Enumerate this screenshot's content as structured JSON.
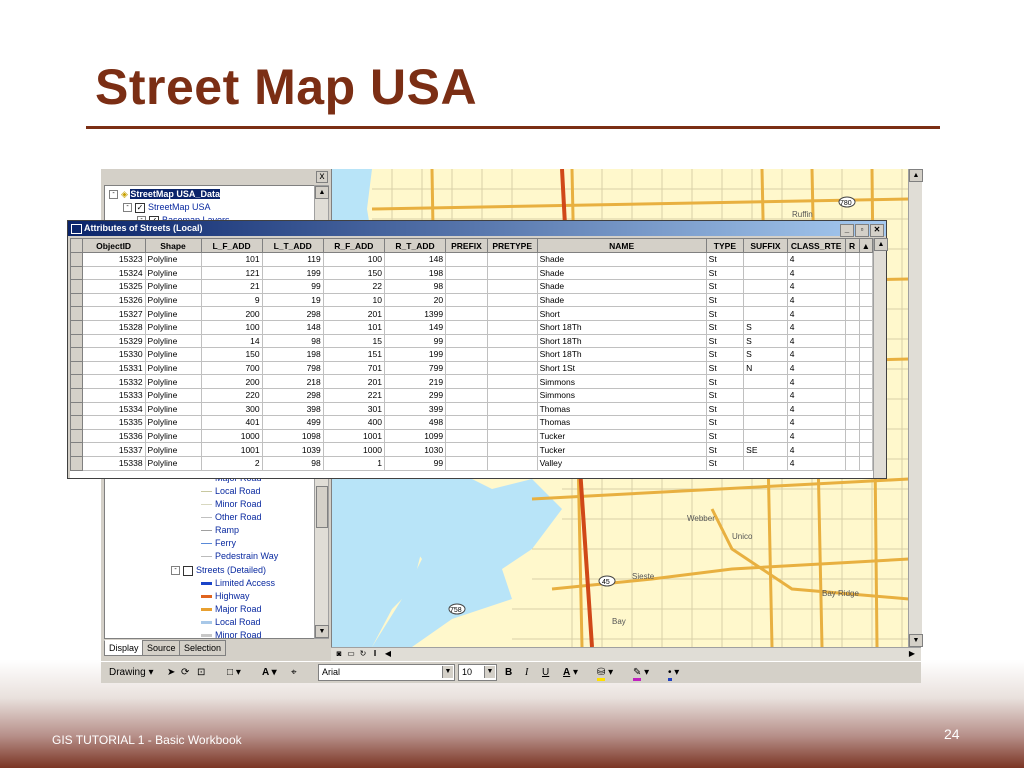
{
  "slide": {
    "title": "Street Map USA",
    "footer": "GIS TUTORIAL 1 - Basic Workbook",
    "page_number": "24"
  },
  "toc": {
    "close_glyph": "x",
    "tree_top": [
      {
        "label": "StreetMap USA_Data",
        "indent": 0,
        "expander": "-",
        "checkbox": false,
        "highlight": true
      },
      {
        "label": "StreetMap USA",
        "indent": 1,
        "expander": "-",
        "checkbox": true
      },
      {
        "label": "Basemap Layers",
        "indent": 2,
        "expander": "-",
        "checkbox": true
      }
    ],
    "legend_items": [
      {
        "label": "Major Road",
        "color": "#c8a060"
      },
      {
        "label": "Local Road",
        "color": "#c8c8a0"
      },
      {
        "label": "Minor Road",
        "color": "#d8d8c0"
      },
      {
        "label": "Other Road",
        "color": "#c0c0c0"
      },
      {
        "label": "Ramp",
        "color": "#a0a0a0"
      },
      {
        "label": "Ferry",
        "color": "#5a8ad8"
      },
      {
        "label": "Pedestrain Way",
        "color": "#ffffff"
      }
    ],
    "streets_detailed": "Streets (Detailed)",
    "detailed_items": [
      {
        "label": "Limited Access",
        "color": "#1a44c8"
      },
      {
        "label": "Highway",
        "color": "#e0641e"
      },
      {
        "label": "Major Road",
        "color": "#e8a030"
      },
      {
        "label": "Local Road",
        "color": "#a8c8e8"
      },
      {
        "label": "Minor Road",
        "color": "#c8c8c8"
      }
    ],
    "tabs": [
      "Display",
      "Source",
      "Selection"
    ]
  },
  "map": {
    "labels": [
      "Ruffin",
      "Bay Ridge",
      "Webber",
      "Sieste",
      "Bay",
      "Unico",
      "45",
      "780",
      "758"
    ],
    "colors": {
      "land": "#fff8cc",
      "water": "#b8e4f8",
      "road_major": "#e8b040",
      "road_highway": "#d04818",
      "road_minor": "#d8d0a8"
    }
  },
  "drawing_toolbar": {
    "drawing_label": "Drawing",
    "font_name": "Arial",
    "font_size": "10",
    "bold": "B",
    "italic": "I",
    "underline": "U",
    "text_tool": "A"
  },
  "attributes": {
    "title": "Attributes of Streets (Local)",
    "columns": [
      "ObjectID",
      "Shape",
      "L_F_ADD",
      "L_T_ADD",
      "R_F_ADD",
      "R_T_ADD",
      "PREFIX",
      "PRETYPE",
      "NAME",
      "TYPE",
      "SUFFIX",
      "CLASS_RTE",
      "R"
    ],
    "rows": [
      [
        "15323",
        "Polyline",
        "101",
        "119",
        "100",
        "148",
        "",
        "",
        "Shade",
        "St",
        "",
        "4"
      ],
      [
        "15324",
        "Polyline",
        "121",
        "199",
        "150",
        "198",
        "",
        "",
        "Shade",
        "St",
        "",
        "4"
      ],
      [
        "15325",
        "Polyline",
        "21",
        "99",
        "22",
        "98",
        "",
        "",
        "Shade",
        "St",
        "",
        "4"
      ],
      [
        "15326",
        "Polyline",
        "9",
        "19",
        "10",
        "20",
        "",
        "",
        "Shade",
        "St",
        "",
        "4"
      ],
      [
        "15327",
        "Polyline",
        "200",
        "298",
        "201",
        "1399",
        "",
        "",
        "Short",
        "St",
        "",
        "4"
      ],
      [
        "15328",
        "Polyline",
        "100",
        "148",
        "101",
        "149",
        "",
        "",
        "Short 18Th",
        "St",
        "S",
        "4"
      ],
      [
        "15329",
        "Polyline",
        "14",
        "98",
        "15",
        "99",
        "",
        "",
        "Short 18Th",
        "St",
        "S",
        "4"
      ],
      [
        "15330",
        "Polyline",
        "150",
        "198",
        "151",
        "199",
        "",
        "",
        "Short 18Th",
        "St",
        "S",
        "4"
      ],
      [
        "15331",
        "Polyline",
        "700",
        "798",
        "701",
        "799",
        "",
        "",
        "Short 1St",
        "St",
        "N",
        "4"
      ],
      [
        "15332",
        "Polyline",
        "200",
        "218",
        "201",
        "219",
        "",
        "",
        "Simmons",
        "St",
        "",
        "4"
      ],
      [
        "15333",
        "Polyline",
        "220",
        "298",
        "221",
        "299",
        "",
        "",
        "Simmons",
        "St",
        "",
        "4"
      ],
      [
        "15334",
        "Polyline",
        "300",
        "398",
        "301",
        "399",
        "",
        "",
        "Thomas",
        "St",
        "",
        "4"
      ],
      [
        "15335",
        "Polyline",
        "401",
        "499",
        "400",
        "498",
        "",
        "",
        "Thomas",
        "St",
        "",
        "4"
      ],
      [
        "15336",
        "Polyline",
        "1000",
        "1098",
        "1001",
        "1099",
        "",
        "",
        "Tucker",
        "St",
        "",
        "4"
      ],
      [
        "15337",
        "Polyline",
        "1001",
        "1039",
        "1000",
        "1030",
        "",
        "",
        "Tucker",
        "St",
        "SE",
        "4"
      ],
      [
        "15338",
        "Polyline",
        "2",
        "98",
        "1",
        "99",
        "",
        "",
        "Valley",
        "St",
        "",
        "4"
      ]
    ]
  }
}
